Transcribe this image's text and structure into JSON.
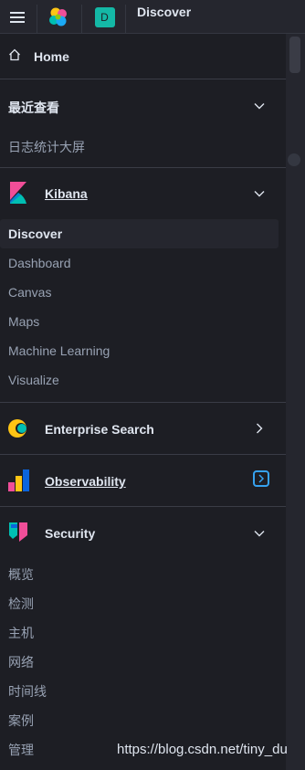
{
  "topbar": {
    "breadcrumb": "Discover",
    "space_initial": "D"
  },
  "nav": {
    "home": "Home",
    "recent": {
      "title": "最近查看",
      "items": [
        "日志统计大屏"
      ]
    },
    "kibana": {
      "title": "Kibana",
      "items": [
        "Discover",
        "Dashboard",
        "Canvas",
        "Maps",
        "Machine Learning",
        "Visualize"
      ],
      "active": "Discover"
    },
    "enterprise_search": {
      "title": "Enterprise Search"
    },
    "observability": {
      "title": "Observability"
    },
    "security": {
      "title": "Security",
      "items": [
        "概览",
        "检测",
        "主机",
        "网络",
        "时间线",
        "案例",
        "管理"
      ]
    }
  },
  "watermark": "https://blog.csdn.net/tiny_du",
  "colors": {
    "background": "#1d1e24",
    "text": "#dfe5ef",
    "muted": "#98a2b3",
    "accent_teal": "#14b8a6",
    "link_blue": "#36a2ef"
  }
}
